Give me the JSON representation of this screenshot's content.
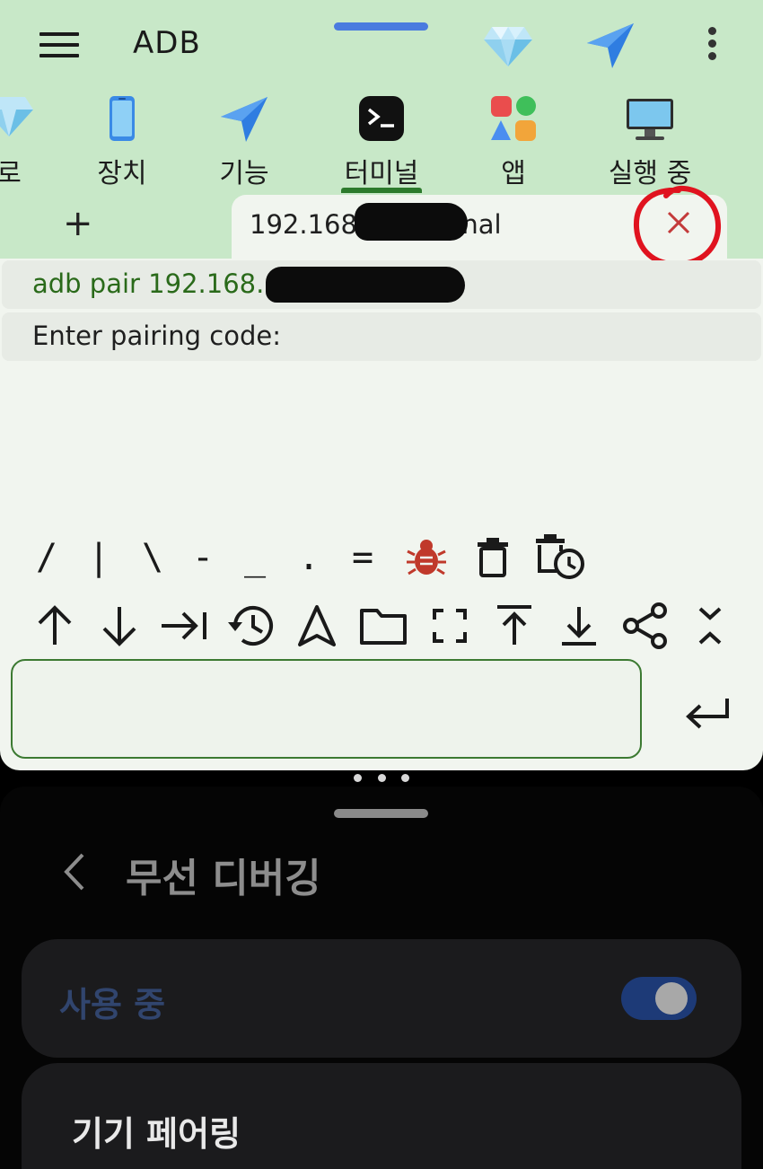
{
  "header": {
    "app_title": "ADB",
    "icons": [
      "menu-icon",
      "gem-icon",
      "send-icon",
      "more-icon"
    ]
  },
  "nav": {
    "items": [
      {
        "label": "로",
        "icon": "gem-icon"
      },
      {
        "label": "장치",
        "icon": "phone-icon"
      },
      {
        "label": "기능",
        "icon": "send-icon"
      },
      {
        "label": "터미널",
        "icon": "terminal-icon",
        "selected": true
      },
      {
        "label": "앱",
        "icon": "apps-icon"
      },
      {
        "label": "실행 중",
        "icon": "monitor-icon"
      }
    ],
    "indicator_color": "#2c7a2c"
  },
  "tabs": {
    "add_label": "+",
    "terminal_tab_label": "192.168.            - Terminal"
  },
  "terminal": {
    "lines": [
      "adb pair 192.168.",
      "Enter pairing code:"
    ],
    "keys_row1": [
      "/",
      "|",
      "\\",
      "-",
      "_",
      ".",
      "="
    ],
    "icon_keys_row1": [
      "bug-icon",
      "delete-icon",
      "delete-clock-icon"
    ],
    "icon_keys_row2": [
      "arrow-up-icon",
      "arrow-down-icon",
      "tab-icon",
      "history-icon",
      "navigation-icon",
      "folder-icon",
      "fullscreen-icon",
      "scroll-top-icon",
      "scroll-bottom-icon",
      "share-icon",
      "collapse-icon"
    ],
    "input_value": "",
    "enter_icon": "enter-icon"
  },
  "settings": {
    "page_title": "무선 디버깅",
    "toggle_label": "사용 중",
    "toggle_on": true,
    "pair_device_label": "기기 페어링"
  },
  "colors": {
    "header_bg": "#c8e8c8",
    "terminal_bg": "#f1f5ef",
    "command_text": "#2a6a1a",
    "close_x": "#c33a3a",
    "annotation_circle": "#e0131f",
    "toggle_track": "#1d3a77"
  }
}
